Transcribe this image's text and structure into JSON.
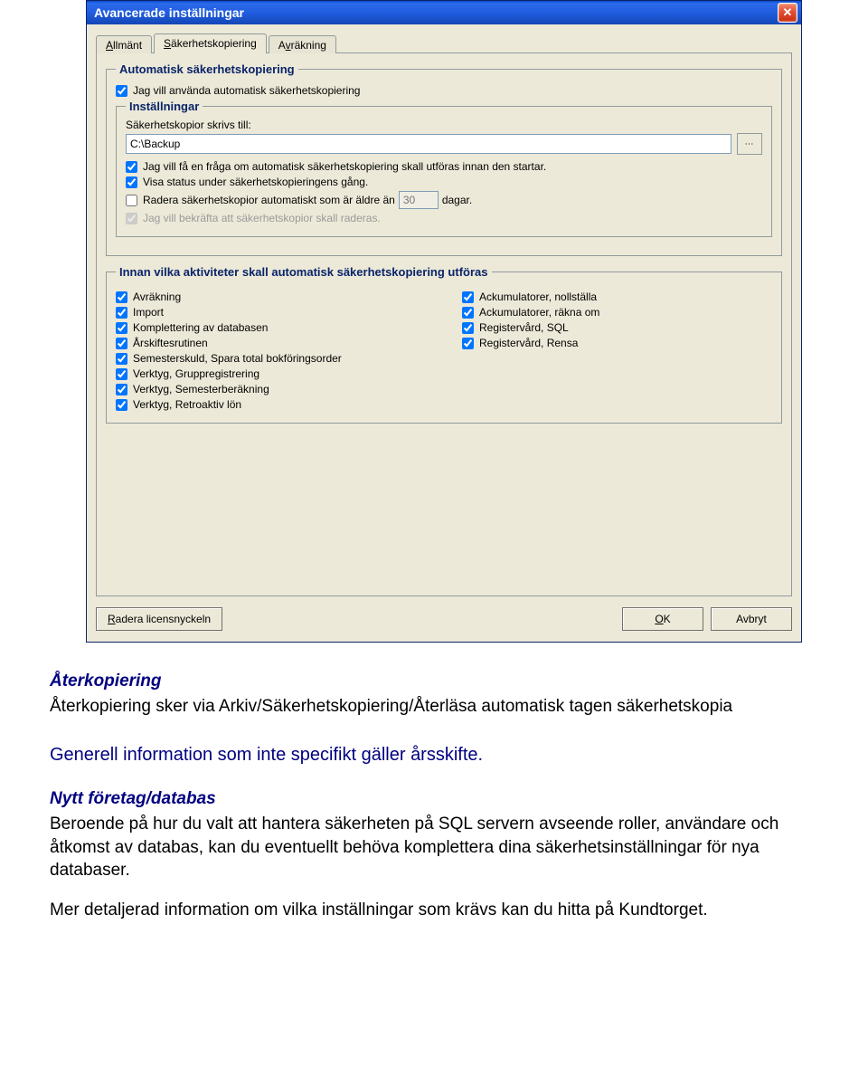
{
  "window": {
    "title": "Avancerade inställningar"
  },
  "tabs": {
    "allmant": "Allmänt",
    "sakerhet": "Säkerhetskopiering",
    "avrakning": "Avräkning"
  },
  "auto_backup": {
    "legend": "Automatisk säkerhetskopiering",
    "use_auto": "Jag vill använda automatisk säkerhetskopiering",
    "settings_legend": "Inställningar",
    "path_label": "Säkerhetskopior skrivs till:",
    "path_value": "C:\\Backup",
    "ask_before": "Jag vill få en fråga om automatisk säkerhetskopiering skall utföras innan den startar.",
    "show_status": "Visa status under säkerhetskopieringens gång.",
    "delete_old_prefix": "Radera säkerhetskopior automatiskt som är äldre än",
    "delete_old_days": "30",
    "delete_old_suffix": "dagar.",
    "confirm_delete": "Jag vill bekräfta att säkerhetskopior skall raderas."
  },
  "activities": {
    "legend": "Innan vilka aktiviteter skall automatisk säkerhetskopiering utföras",
    "left": [
      "Avräkning",
      "Import",
      "Komplettering av databasen",
      "Årskiftesrutinen",
      "Semesterskuld, Spara total bokföringsorder",
      "Verktyg, Gruppregistrering",
      "Verktyg, Semesterberäkning",
      "Verktyg, Retroaktiv lön"
    ],
    "right": [
      "Ackumulatorer, nollställa",
      "Ackumulatorer, räkna om",
      "Registervård, SQL",
      "Registervård, Rensa"
    ]
  },
  "buttons": {
    "delete_license": "Radera licensnyckeln",
    "ok": "OK",
    "cancel": "Avbryt"
  },
  "doc": {
    "h1": "Återkopiering",
    "p1": "Återkopiering sker via Arkiv/Säkerhetskopiering/Återläsa automatisk tagen säkerhetskopia",
    "sub": "Generell information som inte specifikt gäller årsskifte.",
    "h2": "Nytt företag/databas",
    "p2": "Beroende på hur du valt att hantera säkerheten på SQL servern avseende roller, användare och åtkomst av databas, kan du eventuellt behöva komplettera dina säkerhetsinställningar för nya databaser.",
    "p3": "Mer detaljerad information om vilka inställningar som krävs kan du hitta på Kundtorget."
  }
}
